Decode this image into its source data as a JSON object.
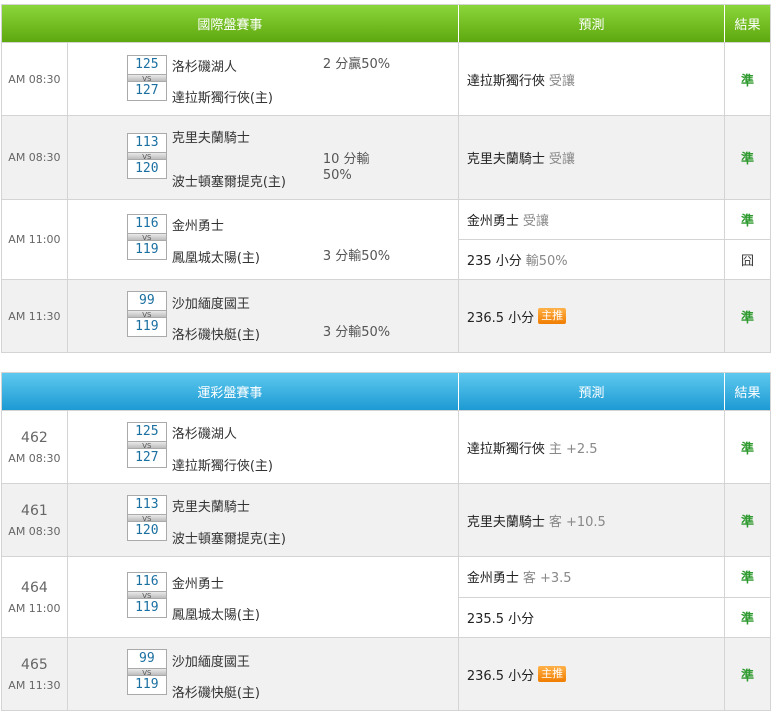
{
  "international": {
    "header": {
      "game": "國際盤賽事",
      "prediction": "預測",
      "result": "結果"
    },
    "rows": [
      {
        "time": "AM 08:30",
        "away": "洛杉磯湖人",
        "home": "達拉斯獨行俠(主)",
        "away_score": "125",
        "home_score": "127",
        "handicap_l1": "2 分贏50%",
        "handicap_l2": "",
        "preds": [
          {
            "team": "達拉斯獨行俠",
            "note": "受讓",
            "result": "準"
          }
        ]
      },
      {
        "time": "AM 08:30",
        "away": "克里夫蘭騎士",
        "home": "波士頓塞爾提克(主)",
        "away_score": "113",
        "home_score": "120",
        "handicap_l1": "10 分輸",
        "handicap_l2": "50%",
        "preds": [
          {
            "team": "克里夫蘭騎士",
            "note": "受讓",
            "result": "準"
          }
        ]
      },
      {
        "time": "AM 11:00",
        "away": "金州勇士",
        "home": "鳳凰城太陽(主)",
        "away_score": "116",
        "home_score": "119",
        "handicap_l1": "3 分輸50%",
        "handicap_l2": "",
        "preds": [
          {
            "team": "金州勇士",
            "note": "受讓",
            "result": "準"
          },
          {
            "team": "235 小分",
            "note": "輸50%",
            "result": "囧"
          }
        ]
      },
      {
        "time": "AM 11:30",
        "away": "沙加緬度國王",
        "home": "洛杉磯快艇(主)",
        "away_score": "99",
        "home_score": "119",
        "handicap_l1": "3 分輸50%",
        "handicap_l2": "",
        "preds": [
          {
            "team": "236.5 小分",
            "note": "",
            "badge": "主推",
            "result": "準"
          }
        ]
      }
    ]
  },
  "lottery": {
    "header": {
      "game": "運彩盤賽事",
      "prediction": "預測",
      "result": "結果"
    },
    "rows": [
      {
        "num": "462",
        "time": "AM 08:30",
        "away": "洛杉磯湖人",
        "home": "達拉斯獨行俠(主)",
        "away_score": "125",
        "home_score": "127",
        "preds": [
          {
            "team": "達拉斯獨行俠",
            "note": "主 +2.5",
            "result": "準"
          }
        ]
      },
      {
        "num": "461",
        "time": "AM 08:30",
        "away": "克里夫蘭騎士",
        "home": "波士頓塞爾提克(主)",
        "away_score": "113",
        "home_score": "120",
        "preds": [
          {
            "team": "克里夫蘭騎士",
            "note": "客 +10.5",
            "result": "準"
          }
        ]
      },
      {
        "num": "464",
        "time": "AM 11:00",
        "away": "金州勇士",
        "home": "鳳凰城太陽(主)",
        "away_score": "116",
        "home_score": "119",
        "preds": [
          {
            "team": "金州勇士",
            "note": "客 +3.5",
            "result": "準"
          },
          {
            "team": "235.5 小分",
            "note": "",
            "result": "準"
          }
        ]
      },
      {
        "num": "465",
        "time": "AM 11:30",
        "away": "沙加緬度國王",
        "home": "洛杉磯快艇(主)",
        "away_score": "99",
        "home_score": "119",
        "preds": [
          {
            "team": "236.5 小分",
            "note": "",
            "badge": "主推",
            "result": "準"
          }
        ]
      }
    ]
  },
  "colors": {
    "intl_header": "#6cbd1e",
    "lottery_header": "#26a5dd",
    "win": "#2f9a2f",
    "badge": "#f28a10"
  }
}
